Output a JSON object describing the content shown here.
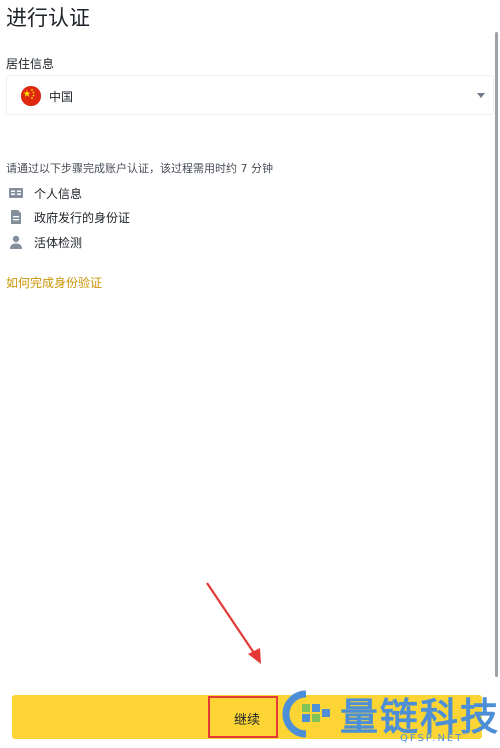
{
  "page": {
    "title": "进行认证"
  },
  "residence": {
    "label": "居住信息",
    "selected": "中国"
  },
  "intro_text": "请通过以下步骤完成账户认证，该过程需用时约 7 分钟",
  "steps": [
    {
      "label": "个人信息",
      "icon": "id-card-icon"
    },
    {
      "label": "政府发行的身份证",
      "icon": "document-icon"
    },
    {
      "label": "活体检测",
      "icon": "person-icon"
    }
  ],
  "help_link": "如何完成身份验证",
  "continue_label": "继续",
  "watermark": {
    "text": "量链科技",
    "sub": "QFSP.NET"
  },
  "colors": {
    "accent": "#fcd535",
    "link": "#c99400",
    "annotation": "#e53935",
    "watermark": "#4d8fd6"
  }
}
